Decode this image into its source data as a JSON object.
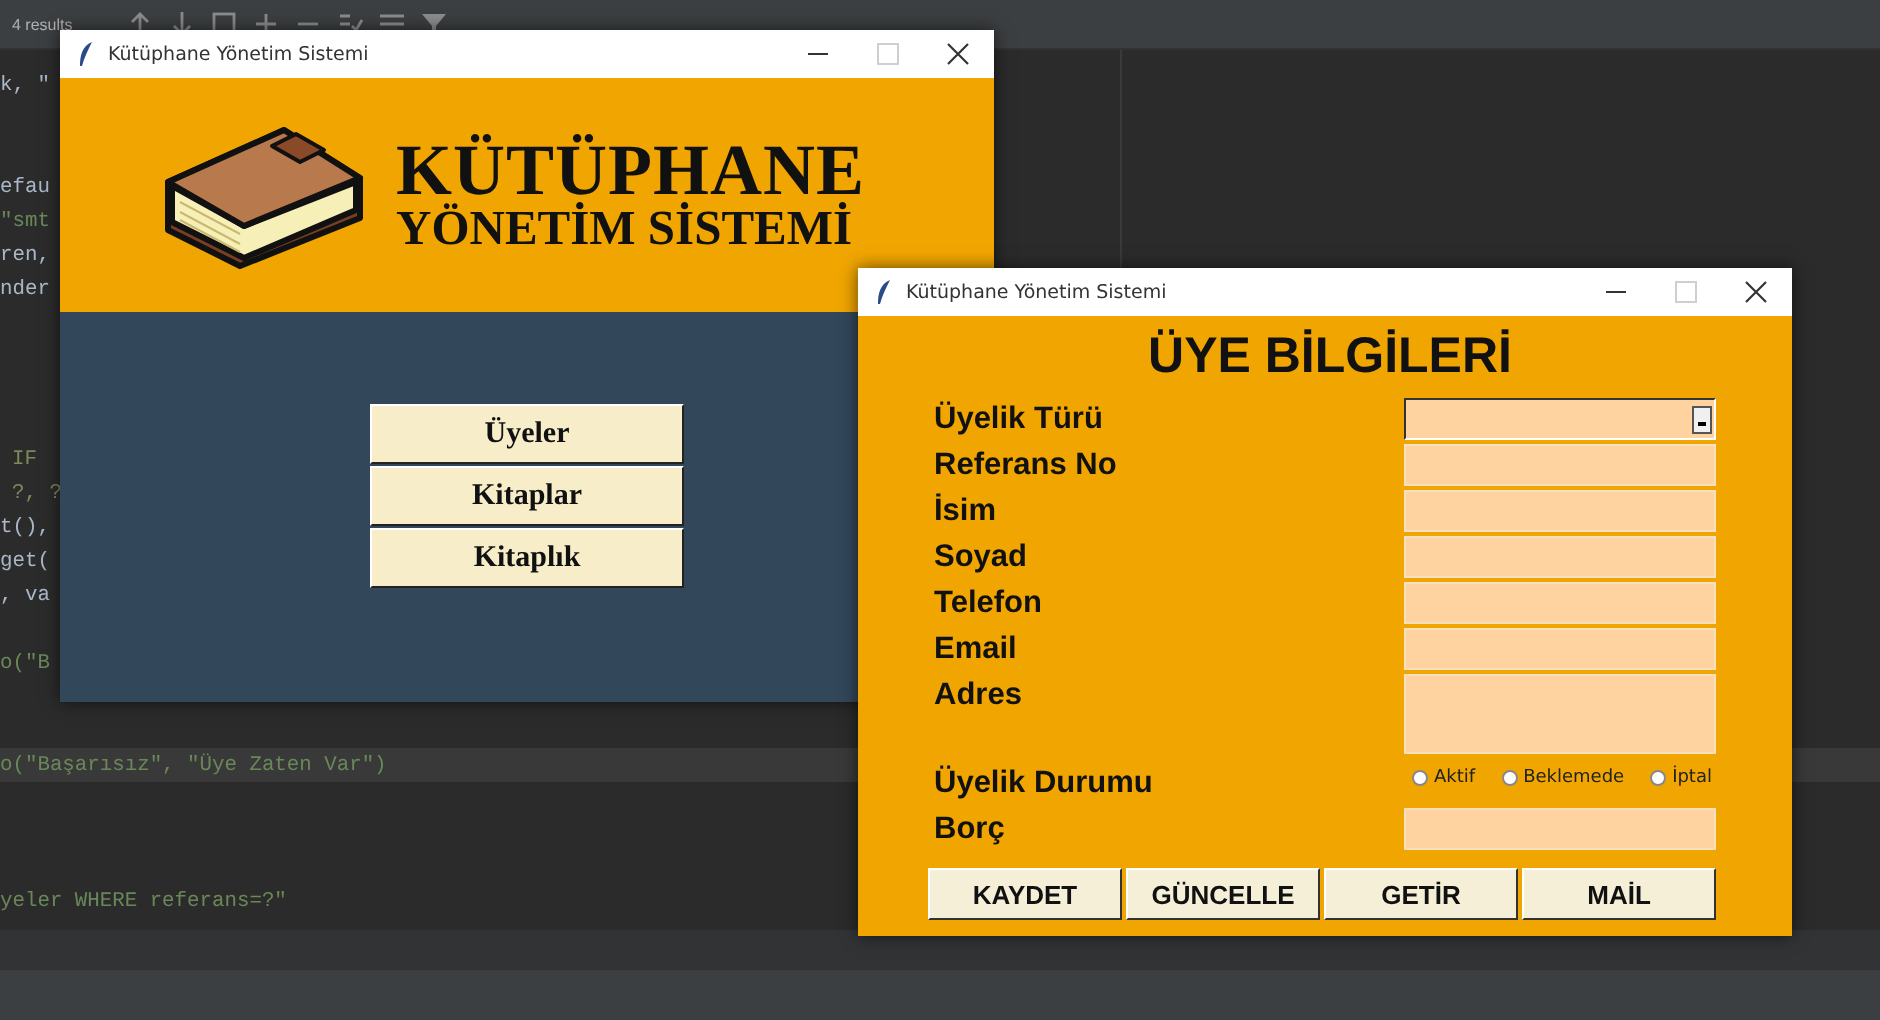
{
  "ide": {
    "find_bar": {
      "results": "4 results"
    },
    "code_lines": [
      {
        "text": "k, \"",
        "kind": "code",
        "current": false
      },
      {
        "text": "efau",
        "kind": "code",
        "current": false
      },
      {
        "text": "\"smt",
        "kind": "string",
        "current": false
      },
      {
        "text": "ren,",
        "kind": "code",
        "current": false
      },
      {
        "text": "nder",
        "kind": "code",
        "current": false
      },
      {
        "text": "IF",
        "kind": "keyword",
        "current": false
      },
      {
        "text": "?, ?",
        "kind": "keyword",
        "current": false
      },
      {
        "text": "t(),",
        "kind": "code",
        "current": false
      },
      {
        "text": "get(",
        "kind": "code",
        "current": false
      },
      {
        "text": ", va",
        "kind": "code",
        "current": false
      },
      {
        "text": "o(\"B",
        "kind": "string",
        "current": false
      },
      {
        "text": "o(\"Başarısız\", \"Üye Zaten Var\")",
        "kind": "string",
        "current": true
      },
      {
        "text": "yeler WHERE referans=?\"",
        "kind": "string",
        "current": false
      }
    ]
  },
  "main_window": {
    "title": "Kütüphane Yönetim Sistemi",
    "maximize_disabled": true,
    "banner": {
      "line_1": "KÜTÜPHANE",
      "line_2": "YÖNETİM SİSTEMİ"
    },
    "buttons": [
      "Üyeler",
      "Kitaplar",
      "Kitaplık"
    ]
  },
  "member_window": {
    "title": "Kütüphane Yönetim Sistemi",
    "maximize_disabled": true,
    "heading": "ÜYE BİLGİLERİ",
    "fields": [
      {
        "label": "Üyelik Türü",
        "kind": "combo"
      },
      {
        "label": "Referans No",
        "kind": "entry"
      },
      {
        "label": "İsim",
        "kind": "entry"
      },
      {
        "label": "Soyad",
        "kind": "entry"
      },
      {
        "label": "Telefon",
        "kind": "entry"
      },
      {
        "label": "Email",
        "kind": "entry"
      },
      {
        "label": "Adres",
        "kind": "text"
      },
      {
        "label": "Üyelik Durumu",
        "kind": "radio",
        "options": [
          {
            "label": "Aktif",
            "selected": false
          },
          {
            "label": "Beklemede",
            "selected": false
          },
          {
            "label": "İptal",
            "selected": false
          }
        ]
      },
      {
        "label": "Borç",
        "kind": "entry"
      }
    ],
    "buttons": [
      "KAYDET",
      "GÜNCELLE",
      "GETİR",
      "MAİL"
    ]
  }
}
